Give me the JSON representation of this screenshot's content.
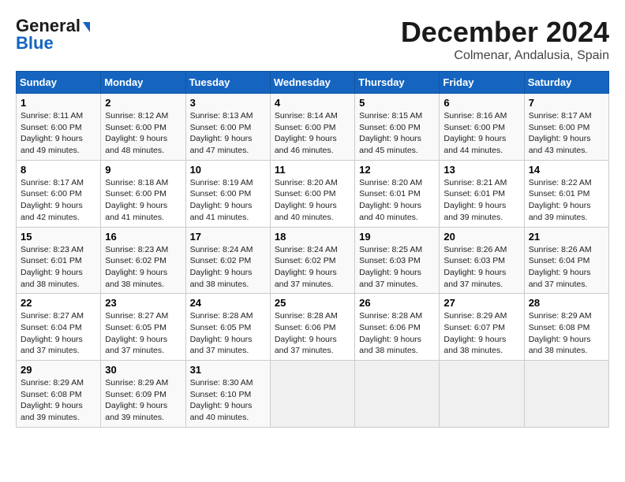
{
  "header": {
    "logo_line1": "General",
    "logo_line2": "Blue",
    "month_title": "December 2024",
    "location": "Colmenar, Andalusia, Spain"
  },
  "calendar": {
    "days_of_week": [
      "Sunday",
      "Monday",
      "Tuesday",
      "Wednesday",
      "Thursday",
      "Friday",
      "Saturday"
    ],
    "weeks": [
      [
        {
          "day": null,
          "info": null
        },
        {
          "day": null,
          "info": null
        },
        {
          "day": null,
          "info": null
        },
        {
          "day": null,
          "info": null
        },
        {
          "day": "5",
          "info": "Sunrise: 8:15 AM\nSunset: 6:00 PM\nDaylight: 9 hours\nand 45 minutes."
        },
        {
          "day": "6",
          "info": "Sunrise: 8:16 AM\nSunset: 6:00 PM\nDaylight: 9 hours\nand 44 minutes."
        },
        {
          "day": "7",
          "info": "Sunrise: 8:17 AM\nSunset: 6:00 PM\nDaylight: 9 hours\nand 43 minutes."
        }
      ],
      [
        {
          "day": "1",
          "info": "Sunrise: 8:11 AM\nSunset: 6:00 PM\nDaylight: 9 hours\nand 49 minutes."
        },
        {
          "day": "2",
          "info": "Sunrise: 8:12 AM\nSunset: 6:00 PM\nDaylight: 9 hours\nand 48 minutes."
        },
        {
          "day": "3",
          "info": "Sunrise: 8:13 AM\nSunset: 6:00 PM\nDaylight: 9 hours\nand 47 minutes."
        },
        {
          "day": "4",
          "info": "Sunrise: 8:14 AM\nSunset: 6:00 PM\nDaylight: 9 hours\nand 46 minutes."
        },
        {
          "day": "5",
          "info": "Sunrise: 8:15 AM\nSunset: 6:00 PM\nDaylight: 9 hours\nand 45 minutes."
        },
        {
          "day": "6",
          "info": "Sunrise: 8:16 AM\nSunset: 6:00 PM\nDaylight: 9 hours\nand 44 minutes."
        },
        {
          "day": "7",
          "info": "Sunrise: 8:17 AM\nSunset: 6:00 PM\nDaylight: 9 hours\nand 43 minutes."
        }
      ],
      [
        {
          "day": "8",
          "info": "Sunrise: 8:17 AM\nSunset: 6:00 PM\nDaylight: 9 hours\nand 42 minutes."
        },
        {
          "day": "9",
          "info": "Sunrise: 8:18 AM\nSunset: 6:00 PM\nDaylight: 9 hours\nand 41 minutes."
        },
        {
          "day": "10",
          "info": "Sunrise: 8:19 AM\nSunset: 6:00 PM\nDaylight: 9 hours\nand 41 minutes."
        },
        {
          "day": "11",
          "info": "Sunrise: 8:20 AM\nSunset: 6:00 PM\nDaylight: 9 hours\nand 40 minutes."
        },
        {
          "day": "12",
          "info": "Sunrise: 8:20 AM\nSunset: 6:01 PM\nDaylight: 9 hours\nand 40 minutes."
        },
        {
          "day": "13",
          "info": "Sunrise: 8:21 AM\nSunset: 6:01 PM\nDaylight: 9 hours\nand 39 minutes."
        },
        {
          "day": "14",
          "info": "Sunrise: 8:22 AM\nSunset: 6:01 PM\nDaylight: 9 hours\nand 39 minutes."
        }
      ],
      [
        {
          "day": "15",
          "info": "Sunrise: 8:23 AM\nSunset: 6:01 PM\nDaylight: 9 hours\nand 38 minutes."
        },
        {
          "day": "16",
          "info": "Sunrise: 8:23 AM\nSunset: 6:02 PM\nDaylight: 9 hours\nand 38 minutes."
        },
        {
          "day": "17",
          "info": "Sunrise: 8:24 AM\nSunset: 6:02 PM\nDaylight: 9 hours\nand 38 minutes."
        },
        {
          "day": "18",
          "info": "Sunrise: 8:24 AM\nSunset: 6:02 PM\nDaylight: 9 hours\nand 37 minutes."
        },
        {
          "day": "19",
          "info": "Sunrise: 8:25 AM\nSunset: 6:03 PM\nDaylight: 9 hours\nand 37 minutes."
        },
        {
          "day": "20",
          "info": "Sunrise: 8:26 AM\nSunset: 6:03 PM\nDaylight: 9 hours\nand 37 minutes."
        },
        {
          "day": "21",
          "info": "Sunrise: 8:26 AM\nSunset: 6:04 PM\nDaylight: 9 hours\nand 37 minutes."
        }
      ],
      [
        {
          "day": "22",
          "info": "Sunrise: 8:27 AM\nSunset: 6:04 PM\nDaylight: 9 hours\nand 37 minutes."
        },
        {
          "day": "23",
          "info": "Sunrise: 8:27 AM\nSunset: 6:05 PM\nDaylight: 9 hours\nand 37 minutes."
        },
        {
          "day": "24",
          "info": "Sunrise: 8:28 AM\nSunset: 6:05 PM\nDaylight: 9 hours\nand 37 minutes."
        },
        {
          "day": "25",
          "info": "Sunrise: 8:28 AM\nSunset: 6:06 PM\nDaylight: 9 hours\nand 37 minutes."
        },
        {
          "day": "26",
          "info": "Sunrise: 8:28 AM\nSunset: 6:06 PM\nDaylight: 9 hours\nand 38 minutes."
        },
        {
          "day": "27",
          "info": "Sunrise: 8:29 AM\nSunset: 6:07 PM\nDaylight: 9 hours\nand 38 minutes."
        },
        {
          "day": "28",
          "info": "Sunrise: 8:29 AM\nSunset: 6:08 PM\nDaylight: 9 hours\nand 38 minutes."
        }
      ],
      [
        {
          "day": "29",
          "info": "Sunrise: 8:29 AM\nSunset: 6:08 PM\nDaylight: 9 hours\nand 39 minutes."
        },
        {
          "day": "30",
          "info": "Sunrise: 8:29 AM\nSunset: 6:09 PM\nDaylight: 9 hours\nand 39 minutes."
        },
        {
          "day": "31",
          "info": "Sunrise: 8:30 AM\nSunset: 6:10 PM\nDaylight: 9 hours\nand 40 minutes."
        },
        {
          "day": null,
          "info": null
        },
        {
          "day": null,
          "info": null
        },
        {
          "day": null,
          "info": null
        },
        {
          "day": null,
          "info": null
        }
      ]
    ]
  }
}
